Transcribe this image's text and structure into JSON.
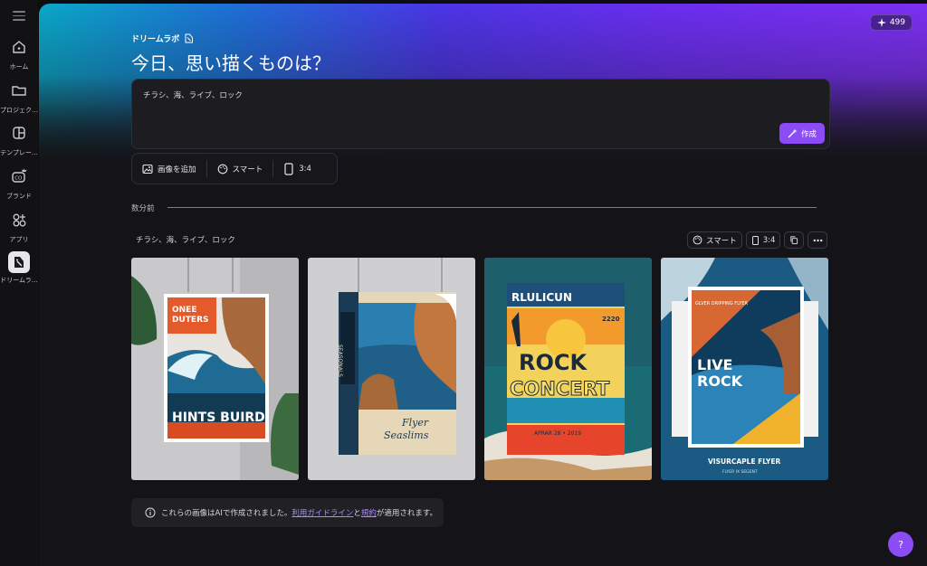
{
  "sidebar": {
    "items": [
      {
        "label": "ホーム",
        "icon": "home-icon"
      },
      {
        "label": "プロジェク…",
        "icon": "folder-icon"
      },
      {
        "label": "テンプレー…",
        "icon": "template-icon"
      },
      {
        "label": "ブランド",
        "icon": "brand-icon"
      },
      {
        "label": "アプリ",
        "icon": "apps-icon"
      },
      {
        "label": "ドリームラ…",
        "icon": "dream-lab-icon"
      }
    ]
  },
  "header": {
    "credits": "499",
    "brand": "ドリームラボ",
    "title": "今日、思い描くものは？"
  },
  "prompt": {
    "text": "チラシ、海、ライブ、ロック",
    "create_label": "作成"
  },
  "options": {
    "add_image": "画像を追加",
    "style": "スマート",
    "ratio": "3:4"
  },
  "history": {
    "time": "数分前",
    "prompt": "チラシ、海、ライブ、ロック",
    "style": "スマート",
    "ratio": "3:4"
  },
  "cards": [
    {
      "top": "ONEE",
      "top2": "DUTERS",
      "bottom": "HINTS BUIRD"
    },
    {
      "bottom1": "Flyer",
      "bottom2": "Seaslims",
      "side": "SEASONALS"
    },
    {
      "head": "RLULICUN",
      "line1": "ROCK",
      "line2": "CONCERT",
      "date": "APRAR 28 • 2019",
      "num": "2220"
    },
    {
      "small": "GLVER DRIPPING FLYER",
      "line1": "LIVE",
      "line2": "ROCK",
      "footer": "VISURCAPLE FLYER",
      "footer2": "FLYER IX SEGENT"
    }
  ],
  "notice": {
    "pre": "これらの画像はAIで作成されました。",
    "link1": "利用ガイドライン",
    "mid": "と",
    "link2": "規約",
    "post": "が適用されます。"
  },
  "help_label": "?",
  "colors": {
    "accent": "#8b4cf6",
    "link": "#a98cff",
    "background": "#141418"
  }
}
